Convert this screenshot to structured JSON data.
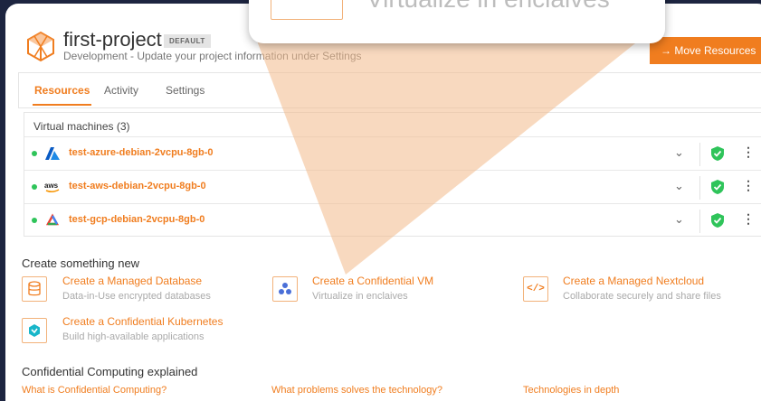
{
  "header": {
    "title": "first-project",
    "badge": "DEFAULT",
    "subtitle": "Development - Update your project information under Settings",
    "move_button": "→ Move Resources"
  },
  "tabs": [
    {
      "label": "Resources",
      "active": true
    },
    {
      "label": "Activity",
      "active": false
    },
    {
      "label": "Settings",
      "active": false
    }
  ],
  "vms": {
    "heading": "Virtual machines (3)",
    "rows": [
      {
        "name": "test-azure-debian-2vcpu-8gb-0",
        "provider": "azure-icon",
        "status": "running"
      },
      {
        "name": "test-aws-debian-2vcpu-8gb-0",
        "provider": "aws-icon",
        "status": "running"
      },
      {
        "name": "test-gcp-debian-2vcpu-8gb-0",
        "provider": "gcp-icon",
        "status": "running"
      }
    ]
  },
  "create": {
    "heading": "Create something new",
    "cards": [
      {
        "title": "Create a Managed Database",
        "desc": "Data-in-Use encrypted databases",
        "icon": "database-icon"
      },
      {
        "title": "Create a Confidential VM",
        "desc": "Virtualize in enclaives",
        "icon": "confidential-vm-icon"
      },
      {
        "title": "Create a Managed Nextcloud",
        "desc": "Collaborate securely and share files",
        "icon": "code-icon"
      },
      {
        "title": "Create a Confidential Kubernetes",
        "desc": "Build high-available applications",
        "icon": "kubernetes-icon"
      }
    ]
  },
  "explained": {
    "heading": "Confidential Computing explained",
    "links": [
      "What is Confidential Computing?",
      "What problems solves the technology?",
      "Technologies in depth"
    ]
  },
  "callout": {
    "text": "Virtualize in enclaives"
  },
  "colors": {
    "accent": "#f07d1f",
    "status_green": "#2fc45a",
    "background": "#1d2540"
  }
}
